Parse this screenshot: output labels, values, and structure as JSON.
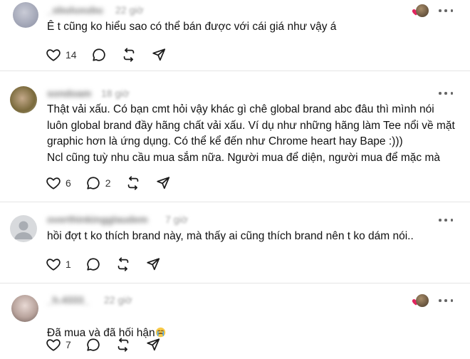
{
  "posts": [
    {
      "username": "_sbuluxubu",
      "time": "22 giờ",
      "text": "Ê t cũng ko hiểu sao có thể bán được với cái giá như vậy á",
      "likes": "14",
      "replies": "",
      "author_liked": true
    },
    {
      "username": "sondoam",
      "time": "18 giờ",
      "text": "Thật vải xấu. Có bạn cmt hỏi vậy khác gì chê global brand abc đâu thì mình nói luôn global brand đầy hãng chất vải xấu. Ví dụ như những hãng làm Tee nổi về mặt graphic hơn là ứng dụng. Có thể kể đến như Chrome heart hay Bape :)))\nNcl cũng tuỳ nhu cầu mua sắm nữa. Người mua để diện, người mua để mặc mà",
      "likes": "6",
      "replies": "2",
      "author_liked": false
    },
    {
      "username": "overthinkingglaudem",
      "time": "7 giờ",
      "text": "hồi đợt t ko thích brand này, mà thấy ai cũng thích brand nên t ko dám nói..",
      "likes": "1",
      "replies": "",
      "author_liked": false
    },
    {
      "username": "_h.4333_",
      "time": "22 giờ",
      "text": "Đã mua và đã hối hận",
      "text_emoji": "crying-face-emoji",
      "likes": "7",
      "replies": "",
      "author_liked": true
    }
  ],
  "icons": {
    "like": "heart-icon",
    "reply": "comment-icon",
    "repost": "repost-icon",
    "share": "send-icon",
    "more": "more-dots-icon"
  },
  "colors": {
    "heart_red": "#e0245e",
    "icon": "#1a1a1a",
    "divider": "#e4e4e4"
  }
}
